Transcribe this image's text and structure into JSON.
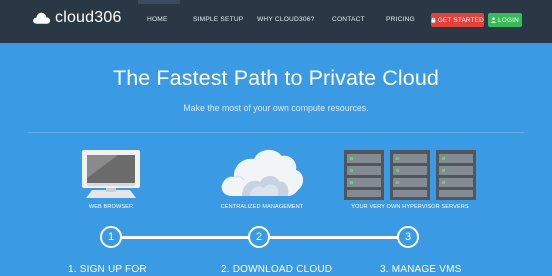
{
  "brand": {
    "name": "cloud306",
    "icon": "cloud-icon"
  },
  "nav": {
    "items": [
      {
        "label": "HOME"
      },
      {
        "label": "SIMPLE SETUP"
      },
      {
        "label": "WHY CLOUD306?"
      },
      {
        "label": "CONTACT"
      },
      {
        "label": "PRICING"
      }
    ],
    "get_started": {
      "label": "GET STARTED",
      "icon": "lock-icon",
      "color": "#e4413a"
    },
    "login": {
      "label": "LOGIN",
      "icon": "user-icon",
      "color": "#38bb59"
    }
  },
  "hero": {
    "title": "The Fastest Path to Private Cloud",
    "subtitle": "Make the most of your own compute resources."
  },
  "illustrations": [
    {
      "icon": "monitor-icon",
      "caption": "WEB BROWSER"
    },
    {
      "icon": "cloud-icon",
      "caption": "CENTRALIZED MANAGEMENT"
    },
    {
      "icon": "servers-icon",
      "caption": "YOUR VERY OWN HYPERVISOR SERVERS"
    }
  ],
  "steps": [
    {
      "number": "1",
      "title": "1. SIGN UP FOR"
    },
    {
      "number": "2",
      "title": "2. DOWNLOAD CLOUD"
    },
    {
      "number": "3",
      "title": "3. MANAGE VMs"
    }
  ],
  "colors": {
    "background": "#3a9be4",
    "topbar": "#2a3745",
    "danger": "#e4413a",
    "success": "#38bb59"
  }
}
